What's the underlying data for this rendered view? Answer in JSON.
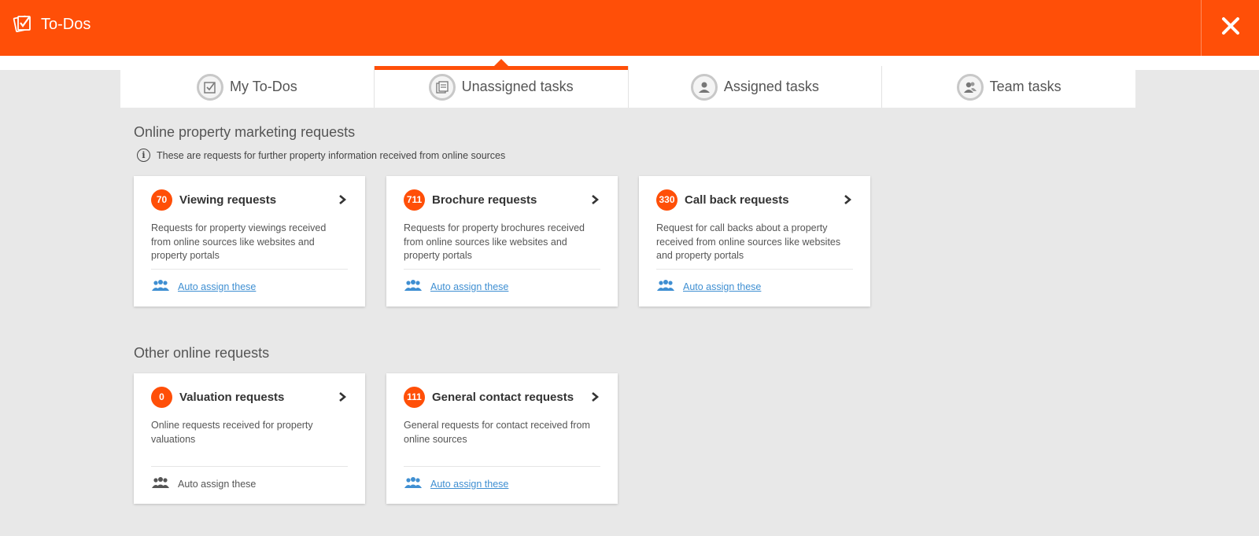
{
  "header": {
    "title": "To-Dos",
    "close_icon": "close-icon",
    "app_icon": "todo-checklist-icon"
  },
  "colors": {
    "accent": "#ff4f08",
    "link": "#3f8fd2",
    "background": "#e8e8e8"
  },
  "tabs": [
    {
      "label": "My To-Dos",
      "icon": "checklist-icon",
      "active": false
    },
    {
      "label": "Unassigned tasks",
      "icon": "documents-icon",
      "active": true
    },
    {
      "label": "Assigned tasks",
      "icon": "person-icon",
      "active": false
    },
    {
      "label": "Team tasks",
      "icon": "team-icon",
      "active": false
    }
  ],
  "sections": {
    "online_marketing": {
      "title": "Online property marketing requests",
      "info": "These are requests for further property information received from online sources",
      "cards": [
        {
          "count": "70",
          "title": "Viewing requests",
          "description": "Requests for property viewings received from online sources like websites and property portals",
          "action": "Auto assign these"
        },
        {
          "count": "711",
          "title": "Brochure requests",
          "description": "Requests for property brochures received from online sources like websites and property portals",
          "action": "Auto assign these"
        },
        {
          "count": "330",
          "title": "Call back requests",
          "description": "Request for call backs about a property received from online sources like websites and property portals",
          "action": "Auto assign these"
        }
      ]
    },
    "other_online": {
      "title": "Other online requests",
      "cards": [
        {
          "count": "0",
          "title": "Valuation requests",
          "description": "Online requests received for property valuations",
          "action": "Auto assign these",
          "action_enabled": false
        },
        {
          "count": "111",
          "title": "General contact requests",
          "description": "General requests for contact received from online sources",
          "action": "Auto assign these",
          "action_enabled": true
        }
      ]
    }
  }
}
